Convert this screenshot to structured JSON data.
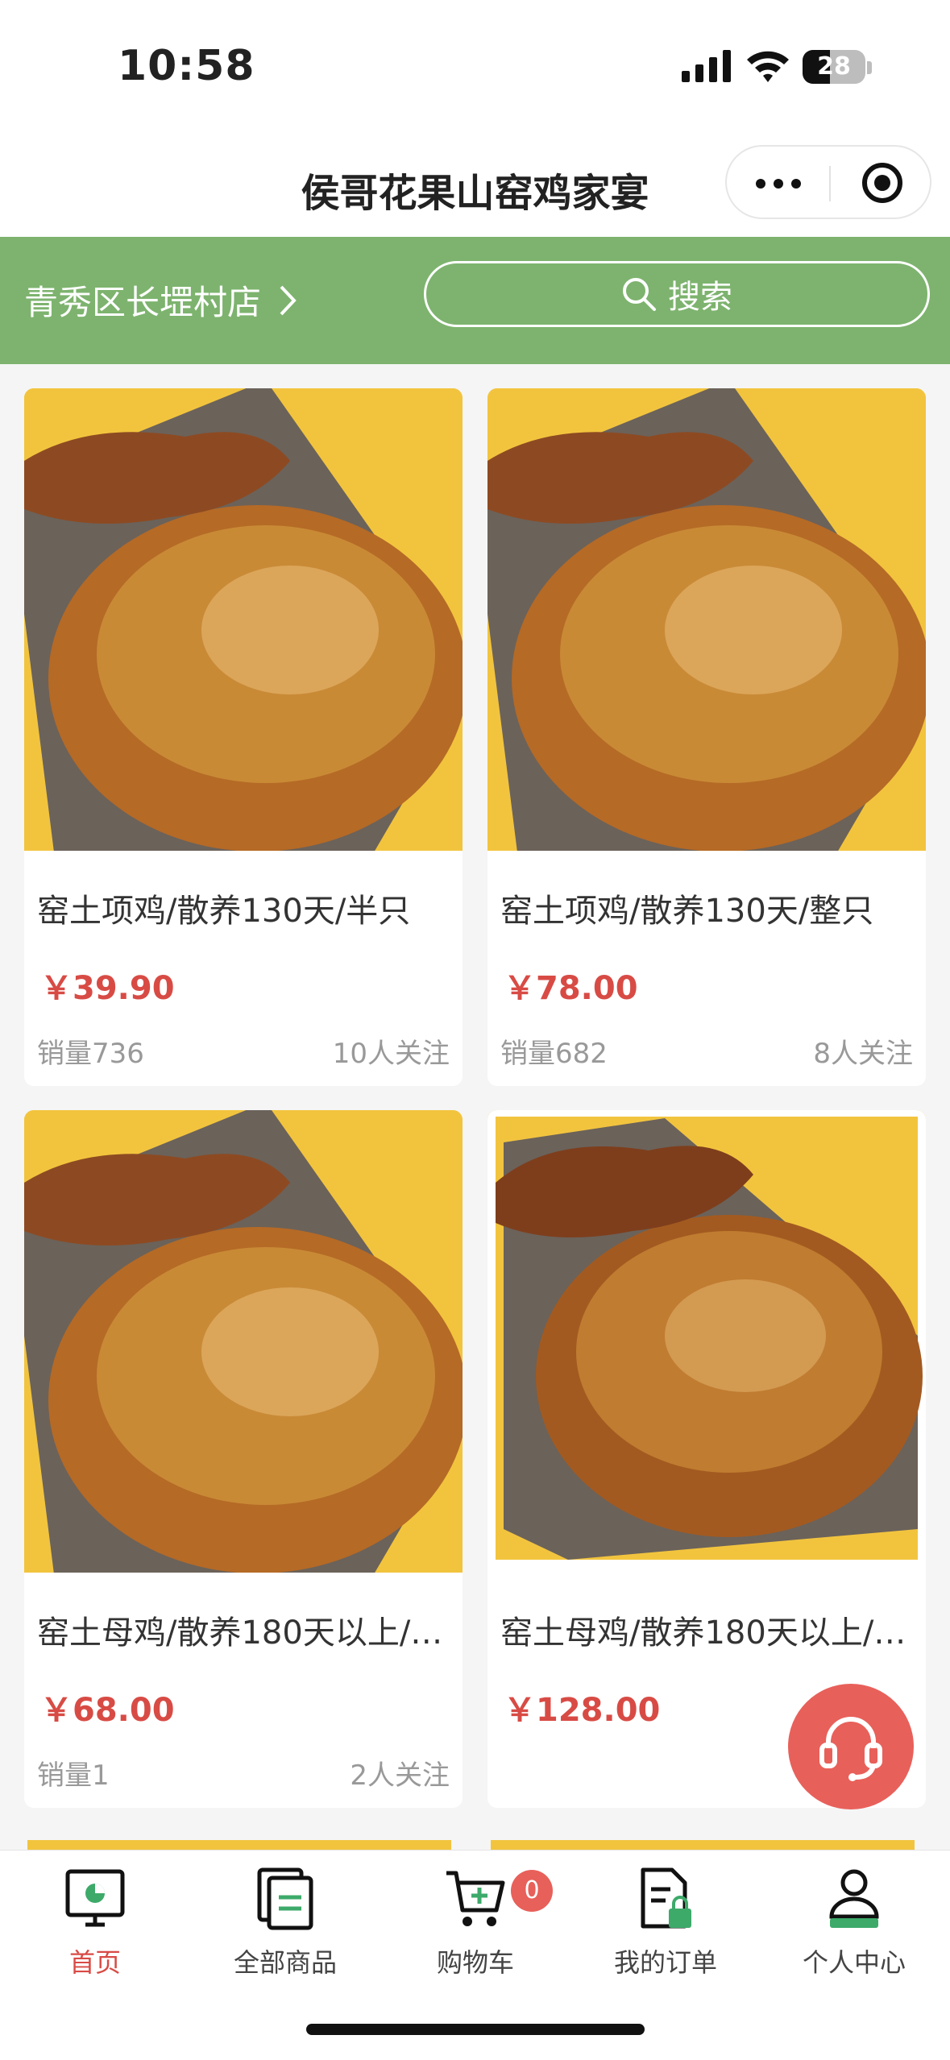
{
  "status": {
    "time": "10:58",
    "battery": "28"
  },
  "app": {
    "title": "侯哥花果山窑鸡家宴"
  },
  "header": {
    "store": "青秀区长堽村店",
    "search_label": "搜索"
  },
  "products": [
    {
      "name": "窑土项鸡/散养130天/半只",
      "price": "￥39.90",
      "sales": "销量736",
      "follow": "10人关注"
    },
    {
      "name": "窑土项鸡/散养130天/整只",
      "price": "￥78.00",
      "sales": "销量682",
      "follow": "8人关注"
    },
    {
      "name": "窑土母鸡/散养180天以上/…",
      "price": "￥68.00",
      "sales": "销量1",
      "follow": "2人关注"
    },
    {
      "name": "窑土母鸡/散养180天以上/…",
      "price": "￥128.00",
      "sales": "",
      "follow": ""
    }
  ],
  "tabbar": {
    "items": [
      {
        "label": "首页",
        "icon": "home-icon",
        "active": true
      },
      {
        "label": "全部商品",
        "icon": "all-products-icon",
        "active": false
      },
      {
        "label": "购物车",
        "icon": "cart-icon",
        "active": false
      },
      {
        "label": "我的订单",
        "icon": "orders-icon",
        "active": false
      },
      {
        "label": "个人中心",
        "icon": "profile-icon",
        "active": false
      }
    ],
    "cart_count": "0"
  },
  "colors": {
    "accent_green": "#7db36e",
    "price_red": "#d84b45",
    "product_bg": "#f2c43e",
    "service_red": "#e8605a"
  }
}
